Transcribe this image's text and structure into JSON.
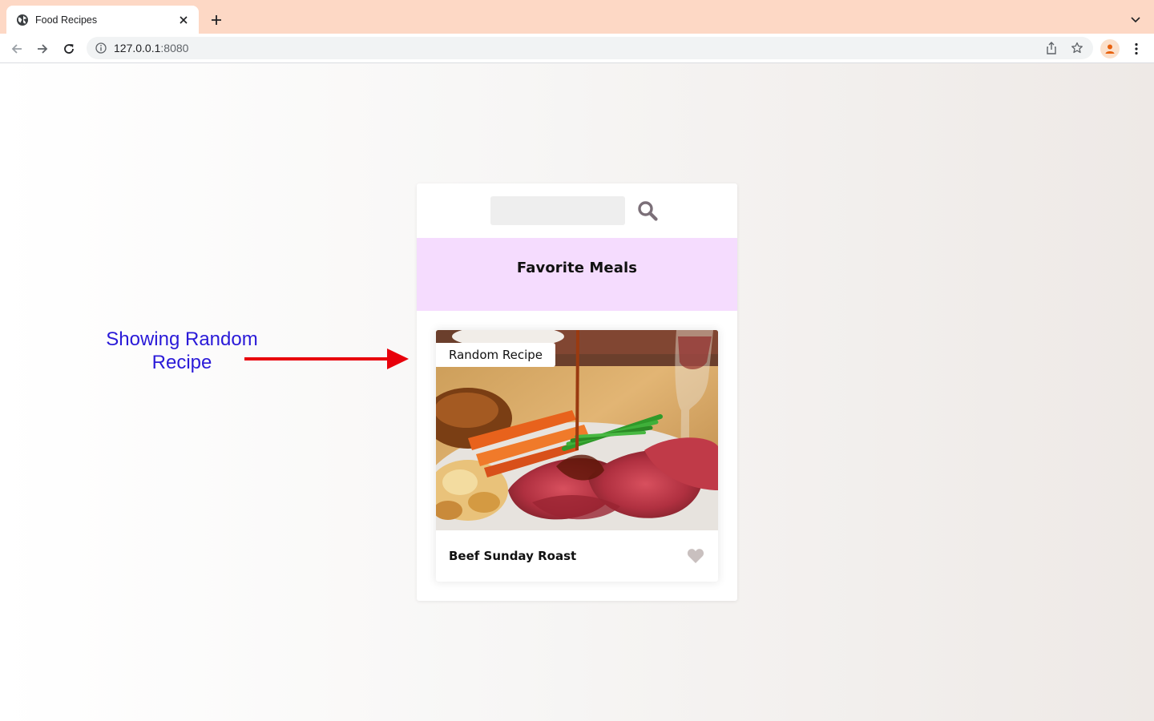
{
  "browser": {
    "tab_title": "Food Recipes",
    "url_host": "127.0.0.1",
    "url_port": ":8080"
  },
  "annotation": {
    "text_line1": "Showing Random",
    "text_line2": "Recipe",
    "color": "#2a1ad8",
    "arrow_color": "#e8000b"
  },
  "app": {
    "search": {
      "value": "",
      "placeholder": ""
    },
    "favorites_title": "Favorite Meals",
    "favorites_bg": "#f5dcfe",
    "meal": {
      "badge": "Random Recipe",
      "name": "Beef Sunday Roast",
      "favorite": false
    }
  }
}
